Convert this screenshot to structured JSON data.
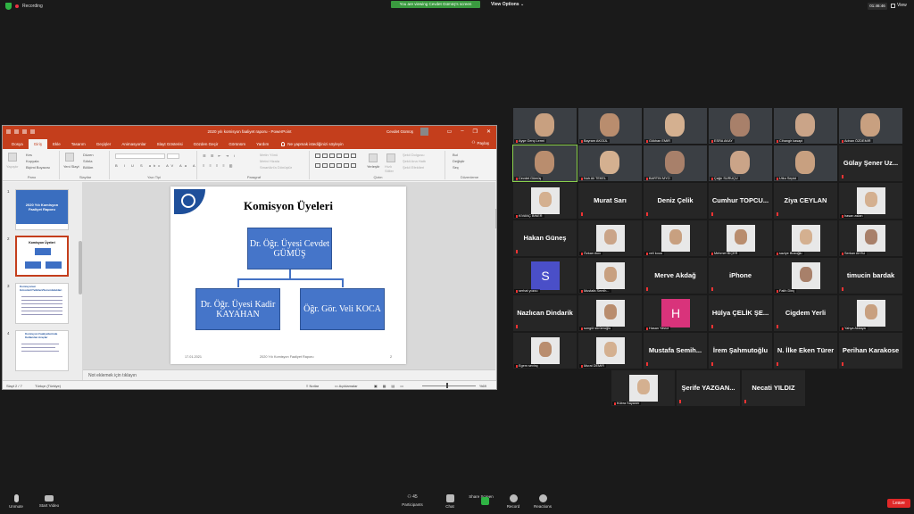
{
  "topbar": {
    "recording": "Recording",
    "viewing_banner": "You are viewing Cevdet Gümüş's screen",
    "view_options": "View Options",
    "timer": "01:46:46",
    "view": "View"
  },
  "ppt": {
    "doc_title": "2020 yılı komisyon faaliyet raporu - PowerPoint",
    "user_name": "Cevdet Gümüş",
    "tabs": [
      "Dosya",
      "Giriş",
      "Ekle",
      "Tasarım",
      "Geçişler",
      "Animasyonlar",
      "Slayt Gösterisi",
      "Gözden Geçir",
      "Görünüm",
      "Yardım"
    ],
    "tell_me": "Ne yapmak istediğinizi söyleyin",
    "share": "Paylaş",
    "ribbon": {
      "paste": "Yapıştır",
      "cut": "Kes",
      "copy": "Kopyala",
      "format_painter": "Biçimi Boyacısı",
      "clipboard": "Pano",
      "new_slide": "Yeni Slayt",
      "layout": "Düzen",
      "reset": "Sıfırla",
      "section": "Bölüm",
      "slides": "Slaytlar",
      "font": "Yazı Tipi",
      "paragraph": "Paragraf",
      "text_direction": "Metin Yönü",
      "align_text": "Metni Hizala",
      "smartart": "SmartArt'a Dönüştür",
      "arrange": "Yerleştir",
      "quick_styles": "Hızlı Stiller",
      "shape_fill": "Şekil Dolgusu",
      "shape_outline": "Şekil Ana Hattı",
      "shape_effects": "Şekil Efektleri",
      "drawing": "Çizim",
      "find": "Bul",
      "replace": "Değiştir",
      "select": "Seç",
      "editing": "Düzenleme"
    },
    "thumbs": {
      "n1": "1",
      "n2": "2",
      "n3": "3",
      "n4": "4",
      "t1_title": "2020 Yılı Komisyon Faaliyet Raporu",
      "t2_title": "Komisyon Üyeleri",
      "t3_title": "Komisyonun Görevleri/Yetkileri/Sorumlulukları",
      "t4_title": "Komisyon Faaliyetlerinde Kullanılan Araçlar"
    },
    "slide": {
      "title": "Komisyon Üyeleri",
      "top_box": "Dr. Öğr. Üyesi Cevdet GÜMÜŞ",
      "left_box": "Dr. Öğr. Üyesi Kadir KAYAHAN",
      "right_box": "Öğr. Gör. Veli KOCA",
      "footer_date": "17.01.2021",
      "footer_text": "2020 Yılı Komisyon Faaliyet Raporu",
      "footer_page": "2"
    },
    "notes_placeholder": "Not eklemek için tıklayın",
    "status": {
      "slide": "Slayt 2 / 7",
      "language": "Türkçe (Türkiye)",
      "notes": "Notlar",
      "comments": "Açıklamalar",
      "zoom": "%69"
    }
  },
  "gallery": [
    {
      "name": "Ayşe Genç Lermi",
      "type": "video"
    },
    {
      "name": "Bayram AKGÜL",
      "type": "video"
    },
    {
      "name": "Gökhan EMİR",
      "type": "video"
    },
    {
      "name": "ESRA AKAY",
      "type": "video"
    },
    {
      "name": "Cihangir kasapi",
      "type": "video"
    },
    {
      "name": "Adnan ÖZDEMİR",
      "type": "video"
    },
    {
      "name": "Cevdet Gümüş",
      "type": "video"
    },
    {
      "name": "Nuh Ali TEKEL",
      "type": "video"
    },
    {
      "name": "BARTIN MYO",
      "type": "video"
    },
    {
      "name": "Çağrı SURUÇU",
      "type": "video"
    },
    {
      "name": "Utku Sepici",
      "type": "video"
    },
    {
      "name": "Gülay Şener Uz...",
      "type": "text"
    },
    {
      "name": "KIVANÇ BİNER",
      "type": "photo"
    },
    {
      "name": "Murat Sarı",
      "type": "text"
    },
    {
      "name": "Deniz Çelik",
      "type": "text"
    },
    {
      "name": "Cumhur TOPCU...",
      "type": "text"
    },
    {
      "name": "Ziya CEYLAN",
      "type": "text"
    },
    {
      "name": "hasan aslan",
      "type": "photo"
    },
    {
      "name": "Hakan Güneş",
      "type": "text"
    },
    {
      "name": "Özkan Avcı",
      "type": "photo"
    },
    {
      "name": "veli koca",
      "type": "photo"
    },
    {
      "name": "Mehmet BİÇER",
      "type": "photo"
    },
    {
      "name": "saziye Bozoğlu",
      "type": "photo"
    },
    {
      "name": "Serkan AKSU",
      "type": "photo"
    },
    {
      "name": "serhat yozcu",
      "type": "letter",
      "letter": "S",
      "color": "#4a4fc8"
    },
    {
      "name": "Mustafa Semih...",
      "type": "photo"
    },
    {
      "name": "Merve Akdağ",
      "type": "text"
    },
    {
      "name": "iPhone",
      "type": "text"
    },
    {
      "name": "Fatih Dinç",
      "type": "photo"
    },
    {
      "name": "timucin bardak",
      "type": "text"
    },
    {
      "name": "Nazlıcan Dindarik",
      "type": "text"
    },
    {
      "name": "songül sürüeroğlu",
      "type": "photo"
    },
    {
      "name": "Hasan Yavuz",
      "type": "letter",
      "letter": "H",
      "color": "#d9337b"
    },
    {
      "name": "Hülya ÇELİK ŞE...",
      "type": "text"
    },
    {
      "name": "Cigdem Yerli",
      "type": "text"
    },
    {
      "name": "Yahya Akkaya",
      "type": "photo"
    },
    {
      "name": "Egem sevinç",
      "type": "photo"
    },
    {
      "name": "Murat DEMİR",
      "type": "photo"
    },
    {
      "name": "Mustafa Semih...",
      "type": "text"
    },
    {
      "name": "İrem Şahmutoğlu",
      "type": "text"
    },
    {
      "name": "N. İlke Eken Türer",
      "type": "text"
    },
    {
      "name": "Perihan Karakose",
      "type": "text"
    },
    {
      "name": "Kübra Sayaner",
      "type": "photo"
    },
    {
      "name": "Şerife YAZGAN...",
      "type": "text"
    },
    {
      "name": "Necati YILDIZ",
      "type": "text"
    }
  ],
  "bottombar": {
    "unmute": "Unmute",
    "start_video": "Start Video",
    "participants": "Participants",
    "participants_count": "45",
    "chat": "Chat",
    "share_screen": "Share Screen",
    "record": "Record",
    "reactions": "Reactions",
    "leave": "Leave"
  }
}
